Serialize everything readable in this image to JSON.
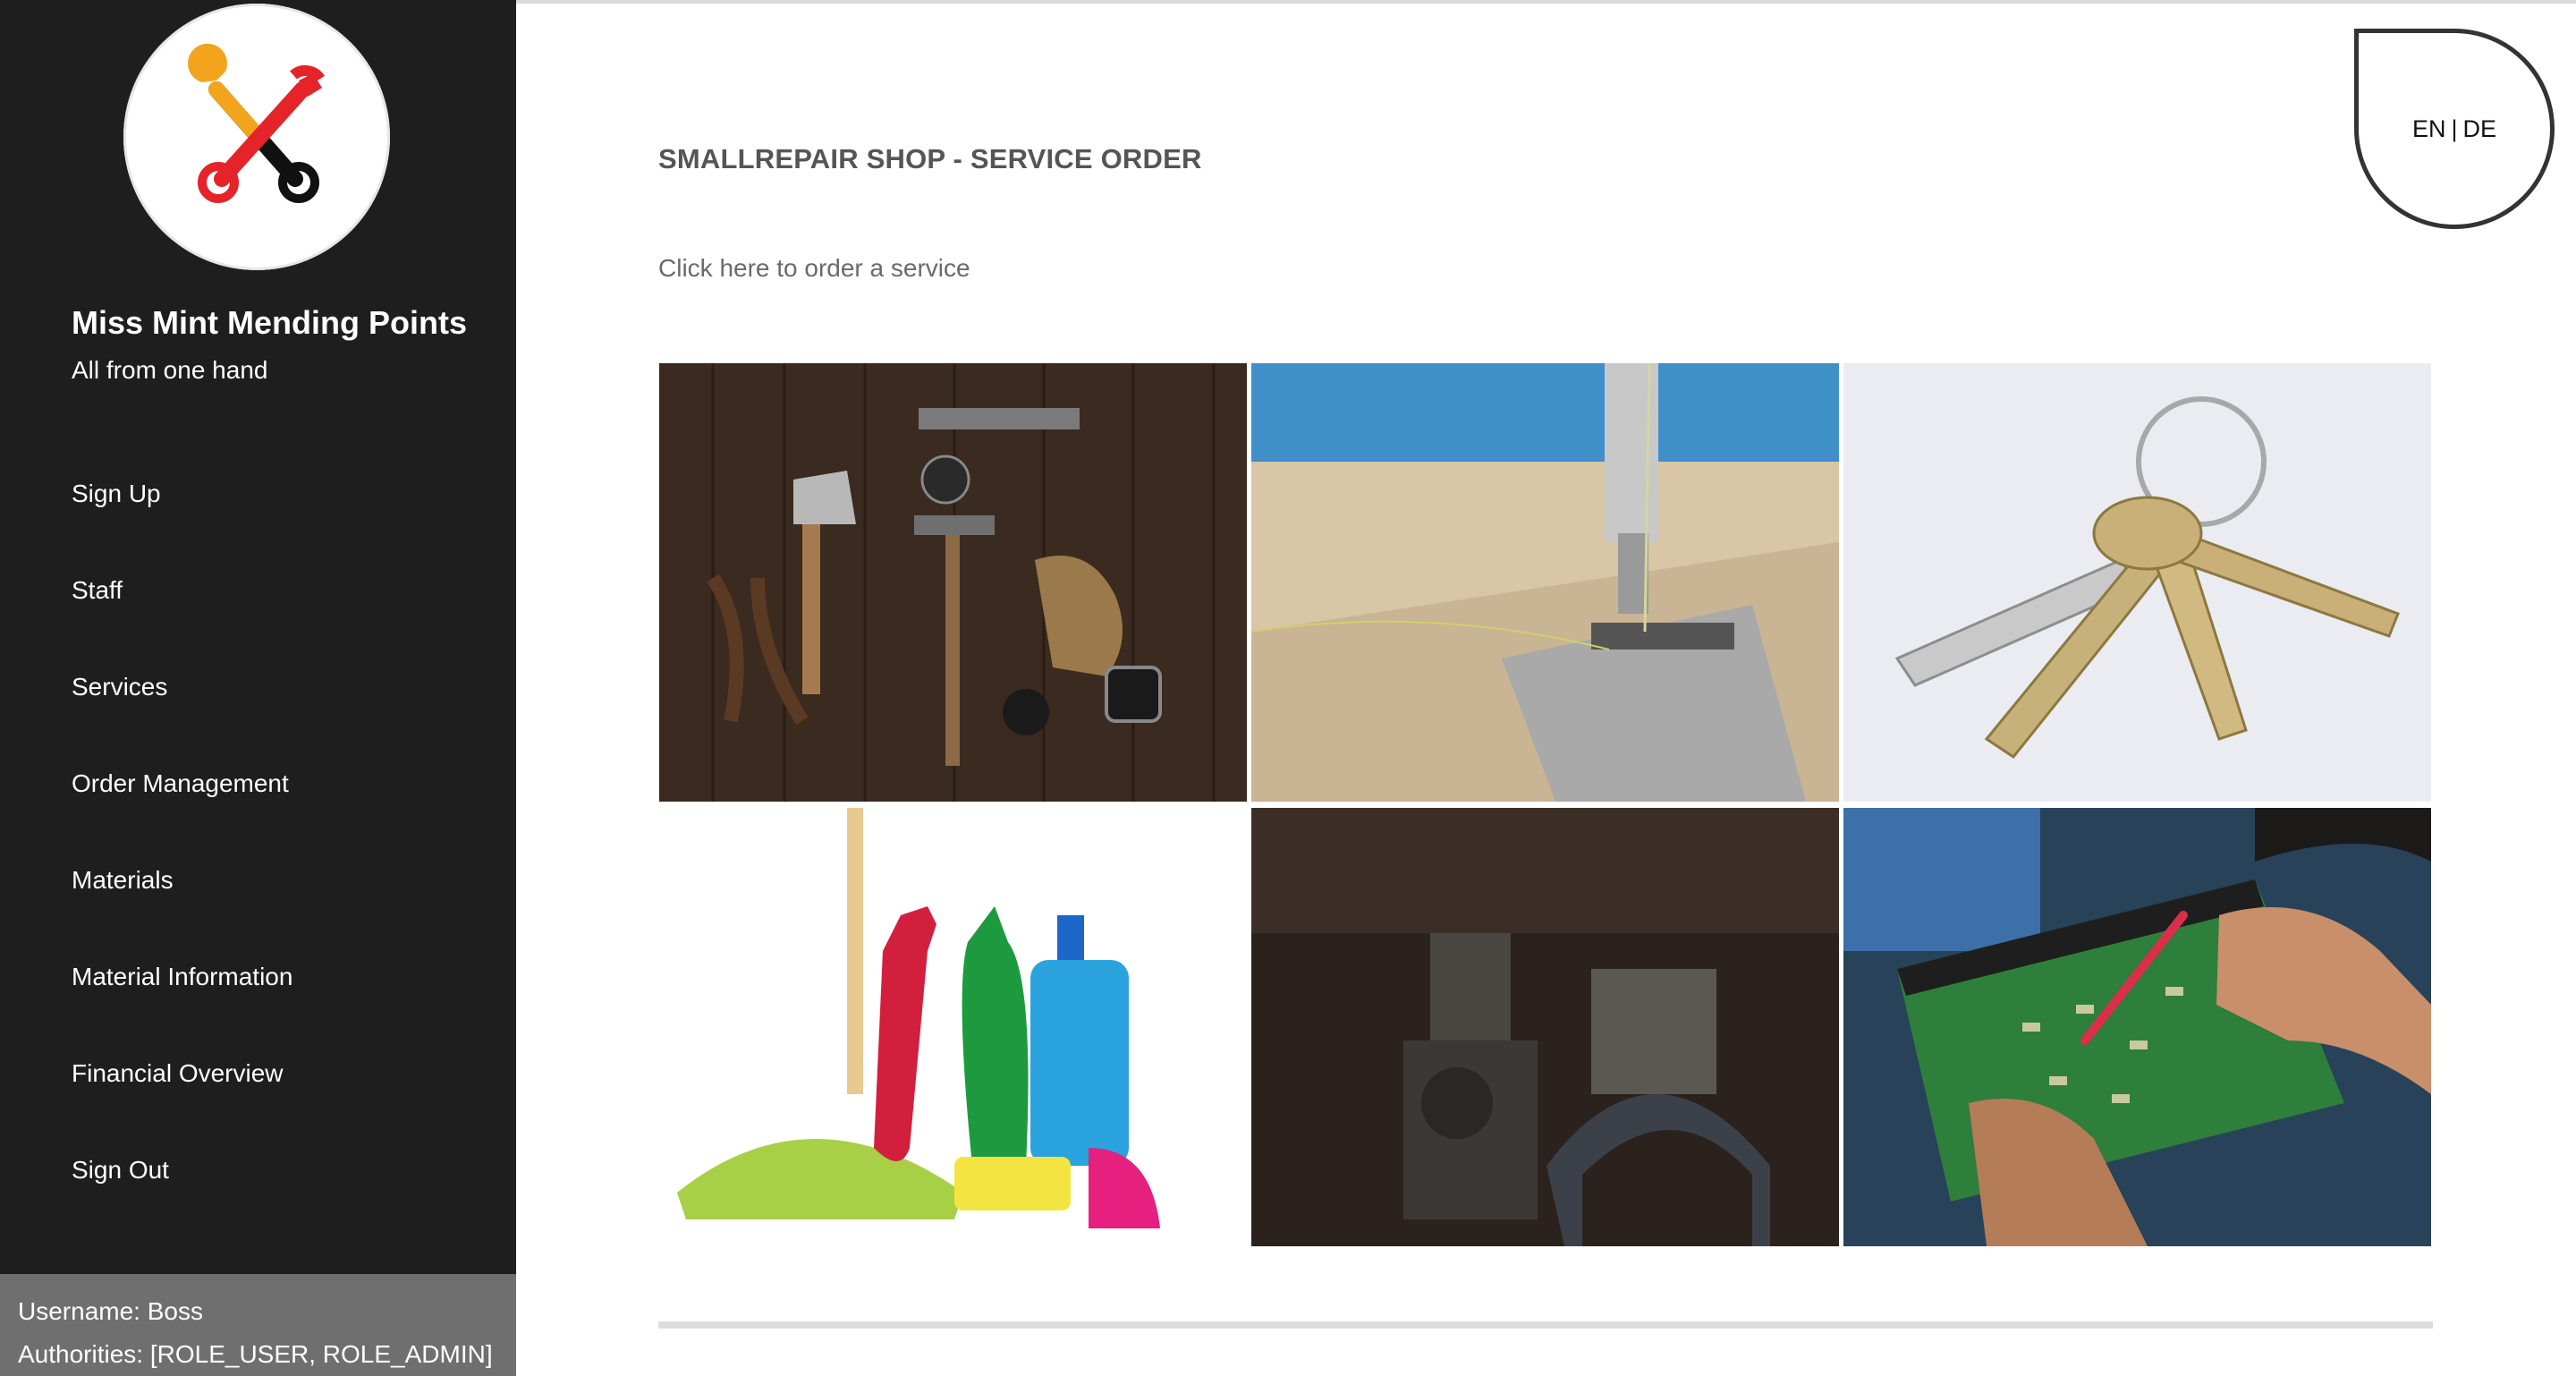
{
  "sidebar": {
    "brand_title": "Miss Mint Mending Points",
    "brand_subtitle": "All from one hand",
    "nav": [
      {
        "label": "Sign Up"
      },
      {
        "label": "Staff"
      },
      {
        "label": "Services"
      },
      {
        "label": "Order Management"
      },
      {
        "label": "Materials"
      },
      {
        "label": "Material Information"
      },
      {
        "label": "Financial Overview"
      },
      {
        "label": "Sign Out"
      }
    ],
    "user": {
      "username": "Username: Boss",
      "authorities": "Authorities: [ROLE_USER, ROLE_ADMIN]"
    }
  },
  "header": {
    "lang_en": "EN",
    "lang_separator": "|",
    "lang_de": "DE"
  },
  "main": {
    "title": "SMALLREPAIR SHOP - SERVICE ORDER",
    "order_link": "Click here to order a service"
  },
  "icons": {
    "logo": "crossed-wrenches-icon"
  },
  "colors": {
    "sidebar_bg": "#1e1e1e",
    "userbox_bg": "#6f6f6f",
    "logo_red": "#e52329",
    "logo_orange": "#f2a51c",
    "logo_black": "#111111"
  }
}
